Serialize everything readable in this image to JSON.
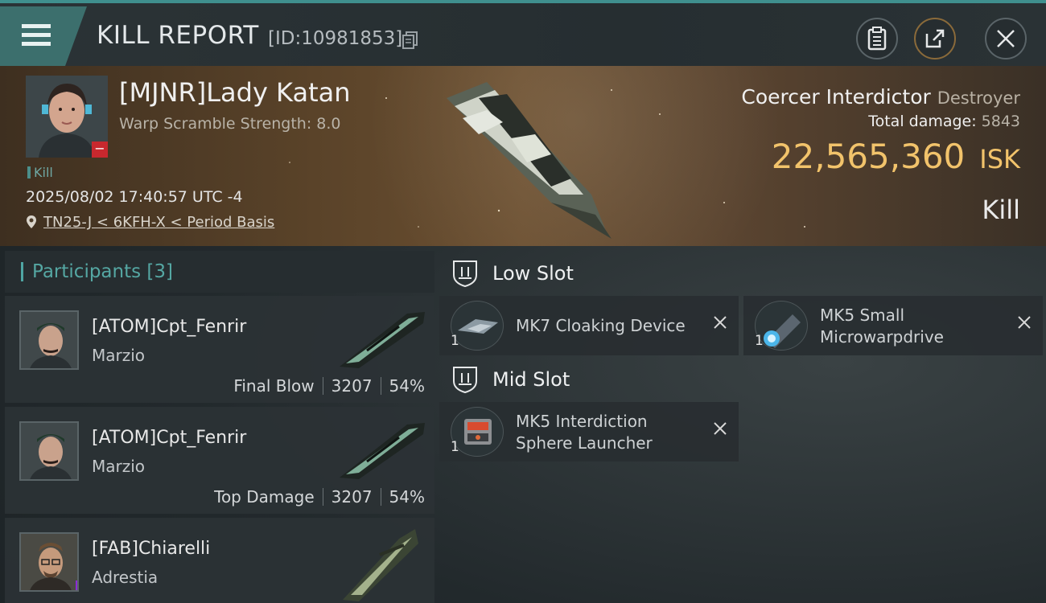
{
  "header": {
    "title": "KILL REPORT",
    "report_id": "[ID:10981853]"
  },
  "victim": {
    "name": "[MJNR]Lady Katan",
    "warp_scramble": "Warp Scramble Strength: 8.0",
    "tag": "Kill",
    "datetime": "2025/08/02 17:40:57 UTC -4",
    "location": "TN25-J < 6KFH-X < Period Basis"
  },
  "ship": {
    "name": "Coercer Interdictor",
    "class": "Destroyer",
    "total_damage_label": "Total damage:",
    "total_damage": "5843",
    "isk_value": "22,565,360",
    "isk_unit": "ISK",
    "result": "Kill"
  },
  "participants": {
    "heading": "Participants [3]",
    "items": [
      {
        "name": "[ATOM]Cpt_Fenrir",
        "ship": "Marzio",
        "role": "Final Blow",
        "damage": "3207",
        "percent": "54%"
      },
      {
        "name": "[ATOM]Cpt_Fenrir",
        "ship": "Marzio",
        "role": "Top Damage",
        "damage": "3207",
        "percent": "54%"
      },
      {
        "name": "[FAB]Chiarelli",
        "ship": "Adrestia"
      }
    ]
  },
  "slots": {
    "low": {
      "title": "Low Slot",
      "modules": [
        {
          "name_line1": "MK7 Cloaking Device",
          "name_line2": "",
          "qty": "1"
        },
        {
          "name_line1": "MK5 Small",
          "name_line2": "Microwarpdrive",
          "qty": "1"
        }
      ]
    },
    "mid": {
      "title": "Mid Slot",
      "modules": [
        {
          "name_line1": "MK5 Interdiction",
          "name_line2": "Sphere Launcher",
          "qty": "1"
        }
      ]
    }
  },
  "colors": {
    "accent": "#4fa5a3",
    "isk": "#f2c36b",
    "badge_red": "#c8282e",
    "badge_purple": "#8b2bd6"
  },
  "icons": [
    "menu-icon",
    "copy-icon",
    "clipboard-icon",
    "share-icon",
    "close-icon",
    "location-pin-icon",
    "slot-shield-icon",
    "remove-x-icon"
  ]
}
